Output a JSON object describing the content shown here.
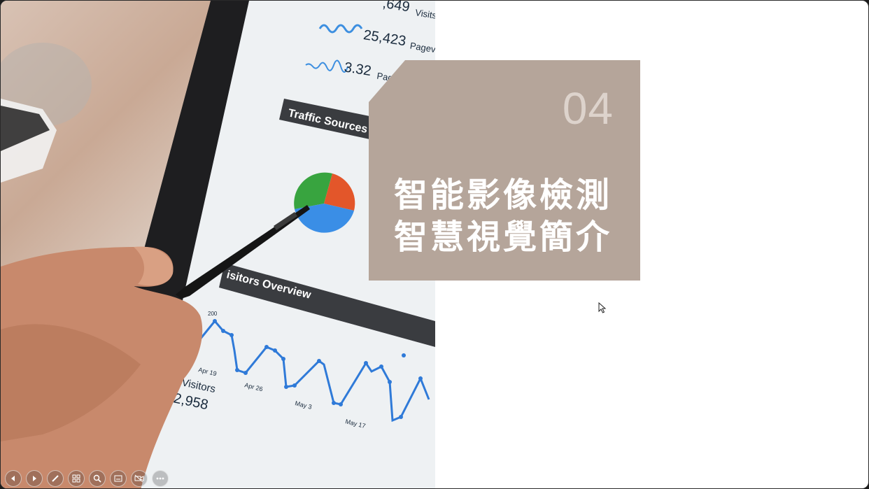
{
  "slide": {
    "number": "04",
    "title_line1": "智能影像檢測",
    "title_line2": "智慧視覺簡介",
    "card_color": "#b5a59a",
    "background_color": "#ffffff"
  },
  "photo": {
    "stats": [
      {
        "value": ",649",
        "label": "Visits"
      },
      {
        "value": "25,423",
        "label": "Pageviews"
      },
      {
        "value": "3.32",
        "label": "Pages"
      }
    ],
    "traffic_header": "Traffic Sources Over",
    "visitors_header": "isitors Overview",
    "visitors_label": "Visitors",
    "visitors_value": "2,958",
    "axis_labels": [
      "Apr 19",
      "Apr 26",
      "May 3",
      "May 17"
    ],
    "y_label": "200"
  },
  "toolbar": {
    "buttons": [
      {
        "name": "previous",
        "icon": "arrow-left-icon"
      },
      {
        "name": "next",
        "icon": "arrow-right-icon"
      },
      {
        "name": "pen",
        "icon": "pen-icon"
      },
      {
        "name": "slides",
        "icon": "see-all-slides-icon"
      },
      {
        "name": "zoom",
        "icon": "zoom-icon"
      },
      {
        "name": "subtitles",
        "icon": "subtitles-icon"
      },
      {
        "name": "camera",
        "icon": "camera-off-icon"
      },
      {
        "name": "more",
        "icon": "more-options-icon"
      }
    ]
  }
}
